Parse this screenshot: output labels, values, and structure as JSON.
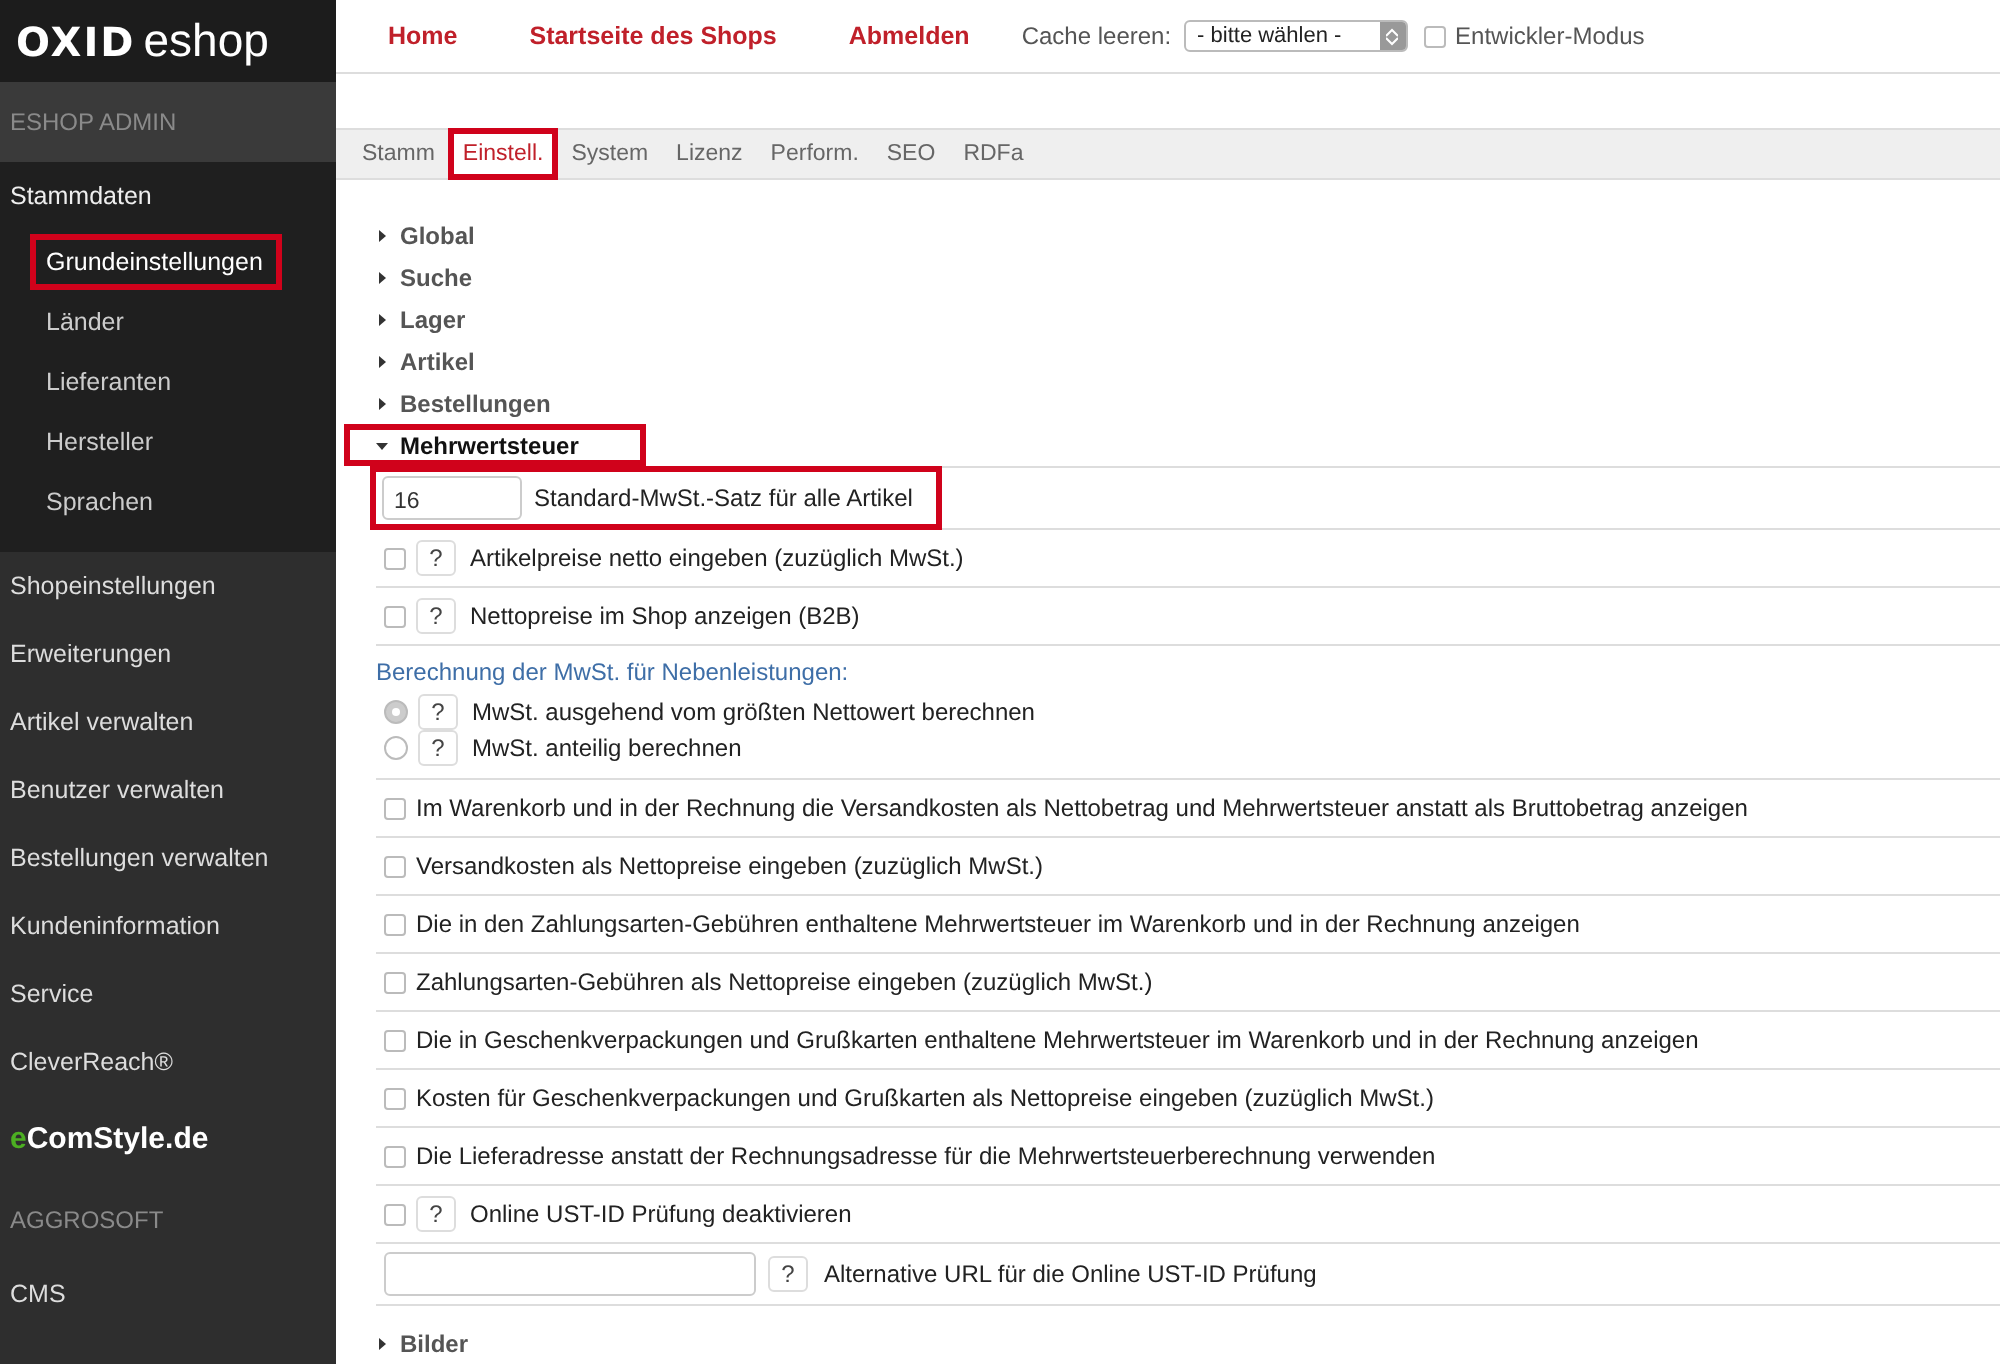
{
  "brand": {
    "mark": "OXID",
    "name": "eshop"
  },
  "top_nav": {
    "links": [
      "Home",
      "Startseite des Shops",
      "Abmelden"
    ],
    "cache_label": "Cache leeren:",
    "cache_select": "- bitte wählen -",
    "dev_mode": {
      "label": "Entwickler-Modus",
      "checked": false
    }
  },
  "sidebar": {
    "sections": [
      {
        "kind": "header",
        "label": "ESHOP ADMIN"
      },
      {
        "kind": "group",
        "label": "Stammdaten",
        "expanded": true,
        "children": [
          {
            "label": "Grundeinstellungen",
            "selected": true,
            "highlighted": true
          },
          {
            "label": "Länder",
            "selected": false,
            "highlighted": false
          },
          {
            "label": "Lieferanten",
            "selected": false,
            "highlighted": false
          },
          {
            "label": "Hersteller",
            "selected": false,
            "highlighted": false
          },
          {
            "label": "Sprachen",
            "selected": false,
            "highlighted": false
          }
        ]
      },
      {
        "kind": "item",
        "label": "Shopeinstellungen"
      },
      {
        "kind": "item",
        "label": "Erweiterungen"
      },
      {
        "kind": "item",
        "label": "Artikel verwalten"
      },
      {
        "kind": "item",
        "label": "Benutzer verwalten"
      },
      {
        "kind": "item",
        "label": "Bestellungen verwalten"
      },
      {
        "kind": "item",
        "label": "Kundeninformation"
      },
      {
        "kind": "item",
        "label": "Service"
      },
      {
        "kind": "item",
        "label": "CleverReach®"
      },
      {
        "kind": "brand",
        "accent": "e",
        "label": "ComStyle.de"
      },
      {
        "kind": "header",
        "label": "AGGROSOFT"
      },
      {
        "kind": "item",
        "label": "CMS"
      }
    ]
  },
  "tabs": [
    {
      "label": "Stamm",
      "selected": false,
      "highlighted": false
    },
    {
      "label": "Einstell.",
      "selected": true,
      "highlighted": true
    },
    {
      "label": "System",
      "selected": false,
      "highlighted": false
    },
    {
      "label": "Lizenz",
      "selected": false,
      "highlighted": false
    },
    {
      "label": "Perform.",
      "selected": false,
      "highlighted": false
    },
    {
      "label": "SEO",
      "selected": false,
      "highlighted": false
    },
    {
      "label": "RDFa",
      "selected": false,
      "highlighted": false
    }
  ],
  "sections": [
    {
      "label": "Global",
      "expanded": false,
      "highlighted": false
    },
    {
      "label": "Suche",
      "expanded": false,
      "highlighted": false
    },
    {
      "label": "Lager",
      "expanded": false,
      "highlighted": false
    },
    {
      "label": "Artikel",
      "expanded": false,
      "highlighted": false
    },
    {
      "label": "Bestellungen",
      "expanded": false,
      "highlighted": false
    },
    {
      "label": "Mehrwertsteuer",
      "expanded": true,
      "highlighted": true,
      "settings": [
        {
          "kind": "text",
          "value": "16",
          "label": "Standard-MwSt.-Satz für alle Artikel",
          "highlighted": true
        },
        {
          "kind": "checkbox",
          "checked": false,
          "help": "?",
          "label": "Artikelpreise netto eingeben (zuzüglich MwSt.)"
        },
        {
          "kind": "checkbox",
          "checked": false,
          "help": "?",
          "label": "Nettopreise im Shop anzeigen (B2B)"
        },
        {
          "kind": "heading",
          "label": "Berechnung der MwSt. für Nebenleistungen:"
        },
        {
          "kind": "radio",
          "selected": true,
          "help": "?",
          "label": "MwSt. ausgehend vom größten Nettowert berechnen"
        },
        {
          "kind": "radio",
          "selected": false,
          "help": "?",
          "label": "MwSt. anteilig berechnen"
        },
        {
          "kind": "checkbox",
          "checked": false,
          "label": "Im Warenkorb und in der Rechnung die Versandkosten als Nettobetrag und Mehrwertsteuer anstatt als Bruttobetrag anzeigen"
        },
        {
          "kind": "checkbox",
          "checked": false,
          "label": "Versandkosten als Nettopreise eingeben (zuzüglich MwSt.)"
        },
        {
          "kind": "checkbox",
          "checked": false,
          "label": "Die in den Zahlungsarten-Gebühren enthaltene Mehrwertsteuer im Warenkorb und in der Rechnung anzeigen"
        },
        {
          "kind": "checkbox",
          "checked": false,
          "label": "Zahlungsarten-Gebühren als Nettopreise eingeben (zuzüglich MwSt.)"
        },
        {
          "kind": "checkbox",
          "checked": false,
          "label": "Die in Geschenkverpackungen und Grußkarten enthaltene Mehrwertsteuer im Warenkorb und in der Rechnung anzeigen"
        },
        {
          "kind": "checkbox",
          "checked": false,
          "label": "Kosten für Geschenkverpackungen und Grußkarten als Nettopreise eingeben (zuzüglich MwSt.)"
        },
        {
          "kind": "checkbox",
          "checked": false,
          "label": "Die Lieferadresse anstatt der Rechnungsadresse für die Mehrwertsteuerberechnung verwenden"
        },
        {
          "kind": "checkbox",
          "checked": false,
          "help": "?",
          "label": "Online UST-ID Prüfung deaktivieren"
        },
        {
          "kind": "text",
          "help": "?",
          "label": "Alternative URL für die Online UST-ID Prüfung",
          "highlighted": false
        }
      ]
    },
    {
      "label": "Bilder",
      "expanded": false,
      "highlighted": false
    }
  ]
}
